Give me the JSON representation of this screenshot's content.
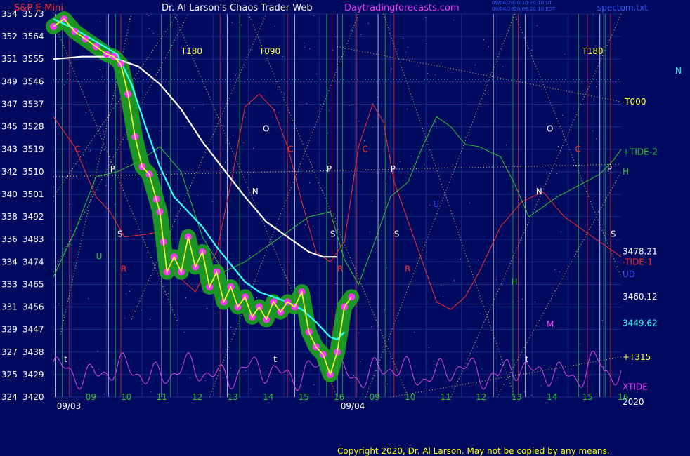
{
  "header": {
    "instrument": "S&P E-Mini",
    "title": "Dr. Al Larson's Chaos Trader Web",
    "site": "Daytradingforecasts.com",
    "stamp_line1": "09/04/2020 10:20:10 UT",
    "stamp_line2": "09/04/2020 06:20:10 EDT",
    "file": "spectom.txt",
    "corner_mark": "N"
  },
  "copyright": "Copyright 2020, Dr. Al Larson. May not be copied by any means.",
  "colors": {
    "background": "#000a5e",
    "price_band": "#1ea51e",
    "price_dots": "#ff33ff",
    "price_line": "#ffff33",
    "white_ma": "#ffffff",
    "cyan_ma": "#33ffff",
    "tide_red": "#ff2a2a",
    "tide_green": "#2ec52e",
    "xtide": "#e040e0"
  },
  "chart_data": {
    "type": "line",
    "title": "S&P E-Mini",
    "y_axis": {
      "ylim": [
        3420,
        3573
      ],
      "ticks": [
        {
          "price": 3573,
          "code": "354"
        },
        {
          "price": 3564,
          "code": "352"
        },
        {
          "price": 3555,
          "code": "351"
        },
        {
          "price": 3546,
          "code": "349"
        },
        {
          "price": 3537,
          "code": "347"
        },
        {
          "price": 3528,
          "code": "345"
        },
        {
          "price": 3519,
          "code": "343"
        },
        {
          "price": 3510,
          "code": "342"
        },
        {
          "price": 3501,
          "code": "340"
        },
        {
          "price": 3492,
          "code": "338"
        },
        {
          "price": 3483,
          "code": "336"
        },
        {
          "price": 3474,
          "code": "334"
        },
        {
          "price": 3465,
          "code": "333"
        },
        {
          "price": 3456,
          "code": "331"
        },
        {
          "price": 3447,
          "code": "329"
        },
        {
          "price": 3438,
          "code": "327"
        },
        {
          "price": 3429,
          "code": "325"
        },
        {
          "price": 3420,
          "code": "324"
        }
      ]
    },
    "x_axis": {
      "xlim": [
        0,
        32
      ],
      "hour_ticks": [
        {
          "x": 1,
          "label": "09"
        },
        {
          "x": 2,
          "label": "10"
        },
        {
          "x": 3,
          "label": "11"
        },
        {
          "x": 4,
          "label": "12"
        },
        {
          "x": 5,
          "label": "13"
        },
        {
          "x": 6,
          "label": "14"
        },
        {
          "x": 7,
          "label": "15"
        },
        {
          "x": 8,
          "label": "16"
        },
        {
          "x": 9,
          "label": "09"
        },
        {
          "x": 10,
          "label": "10"
        },
        {
          "x": 11,
          "label": "11"
        },
        {
          "x": 12,
          "label": "12"
        },
        {
          "x": 13,
          "label": "13"
        },
        {
          "x": 14,
          "label": "14"
        },
        {
          "x": 15,
          "label": "15"
        },
        {
          "x": 16,
          "label": "16"
        }
      ],
      "date_labels": [
        {
          "x": 0.5,
          "label": "09/03"
        },
        {
          "x": 8.5,
          "label": "09/04"
        }
      ]
    },
    "series": [
      {
        "name": "price",
        "points": [
          [
            0,
            3568
          ],
          [
            0.3,
            3571
          ],
          [
            0.6,
            3566
          ],
          [
            0.9,
            3563
          ],
          [
            1.2,
            3560
          ],
          [
            1.5,
            3557
          ],
          [
            1.7,
            3556
          ],
          [
            1.9,
            3553
          ],
          [
            2.1,
            3541
          ],
          [
            2.3,
            3524
          ],
          [
            2.5,
            3512
          ],
          [
            2.7,
            3509
          ],
          [
            2.9,
            3499
          ],
          [
            3.0,
            3494
          ],
          [
            3.1,
            3482
          ],
          [
            3.2,
            3470
          ],
          [
            3.4,
            3476
          ],
          [
            3.6,
            3470
          ],
          [
            3.8,
            3484
          ],
          [
            4.0,
            3472
          ],
          [
            4.2,
            3478
          ],
          [
            4.4,
            3464
          ],
          [
            4.6,
            3470
          ],
          [
            4.8,
            3458
          ],
          [
            5.0,
            3464
          ],
          [
            5.2,
            3456
          ],
          [
            5.4,
            3460
          ],
          [
            5.6,
            3452
          ],
          [
            5.8,
            3456
          ],
          [
            6.0,
            3451
          ],
          [
            6.2,
            3458
          ],
          [
            6.4,
            3454
          ],
          [
            6.6,
            3458
          ],
          [
            6.8,
            3456
          ],
          [
            7.0,
            3462
          ],
          [
            7.2,
            3446
          ],
          [
            7.4,
            3440
          ],
          [
            7.6,
            3437
          ],
          [
            7.8,
            3429
          ],
          [
            8.0,
            3438
          ],
          [
            8.2,
            3456
          ],
          [
            8.4,
            3460
          ]
        ]
      },
      {
        "name": "white average",
        "points": [
          [
            0,
            3555
          ],
          [
            0.8,
            3556
          ],
          [
            1.6,
            3556
          ],
          [
            2.4,
            3552
          ],
          [
            3.0,
            3545
          ],
          [
            3.6,
            3535
          ],
          [
            4.2,
            3522
          ],
          [
            4.8,
            3511
          ],
          [
            5.4,
            3500
          ],
          [
            6.0,
            3490
          ],
          [
            6.6,
            3484
          ],
          [
            7.2,
            3478
          ],
          [
            7.6,
            3476
          ],
          [
            8.0,
            3476
          ]
        ]
      },
      {
        "name": "cyan average",
        "points": [
          [
            0,
            3571
          ],
          [
            0.6,
            3567
          ],
          [
            1.2,
            3562
          ],
          [
            1.8,
            3557
          ],
          [
            2.2,
            3545
          ],
          [
            2.6,
            3528
          ],
          [
            3.0,
            3512
          ],
          [
            3.4,
            3500
          ],
          [
            3.8,
            3494
          ],
          [
            4.2,
            3488
          ],
          [
            4.6,
            3480
          ],
          [
            5.0,
            3473
          ],
          [
            5.4,
            3466
          ],
          [
            5.8,
            3462
          ],
          [
            6.2,
            3460
          ],
          [
            6.6,
            3458
          ],
          [
            7.0,
            3455
          ],
          [
            7.4,
            3450
          ],
          [
            7.8,
            3444
          ],
          [
            8.0,
            3443
          ],
          [
            8.2,
            3446
          ]
        ]
      },
      {
        "name": "tide red",
        "points": [
          [
            0,
            3532
          ],
          [
            0.6,
            3520
          ],
          [
            1.2,
            3500
          ],
          [
            1.6,
            3494
          ],
          [
            2.0,
            3484
          ],
          [
            2.6,
            3485
          ],
          [
            3.0,
            3486
          ],
          [
            3.4,
            3470
          ],
          [
            4.0,
            3462
          ],
          [
            4.6,
            3478
          ],
          [
            5.0,
            3505
          ],
          [
            5.4,
            3536
          ],
          [
            5.8,
            3541
          ],
          [
            6.2,
            3535
          ],
          [
            6.6,
            3520
          ],
          [
            7.0,
            3498
          ],
          [
            7.4,
            3478
          ],
          [
            7.8,
            3474
          ],
          [
            8.2,
            3482
          ],
          [
            8.6,
            3520
          ],
          [
            9.0,
            3537
          ],
          [
            9.3,
            3530
          ],
          [
            9.6,
            3506
          ],
          [
            10.0,
            3490
          ],
          [
            10.4,
            3474
          ],
          [
            10.8,
            3458
          ],
          [
            11.2,
            3455
          ],
          [
            11.6,
            3460
          ],
          [
            12.0,
            3470
          ],
          [
            12.6,
            3488
          ],
          [
            13.2,
            3498
          ],
          [
            13.8,
            3502
          ],
          [
            14.4,
            3492
          ],
          [
            15.0,
            3486
          ],
          [
            15.6,
            3480
          ],
          [
            16.0,
            3476
          ]
        ]
      },
      {
        "name": "tide green",
        "points": [
          [
            0,
            3468
          ],
          [
            0.6,
            3486
          ],
          [
            1.2,
            3508
          ],
          [
            1.8,
            3510
          ],
          [
            2.4,
            3514
          ],
          [
            3.0,
            3520
          ],
          [
            3.6,
            3510
          ],
          [
            4.2,
            3484
          ],
          [
            4.8,
            3470
          ],
          [
            5.4,
            3474
          ],
          [
            6.0,
            3480
          ],
          [
            6.6,
            3486
          ],
          [
            7.2,
            3492
          ],
          [
            7.8,
            3494
          ],
          [
            8.2,
            3475
          ],
          [
            8.6,
            3465
          ],
          [
            9.0,
            3480
          ],
          [
            9.5,
            3500
          ],
          [
            10.0,
            3506
          ],
          [
            10.4,
            3520
          ],
          [
            10.8,
            3532
          ],
          [
            11.2,
            3528
          ],
          [
            11.6,
            3521
          ],
          [
            12.0,
            3520
          ],
          [
            12.6,
            3516
          ],
          [
            13.0,
            3505
          ],
          [
            13.4,
            3492
          ],
          [
            13.8,
            3496
          ],
          [
            14.2,
            3500
          ],
          [
            14.6,
            3503
          ],
          [
            15.0,
            3506
          ],
          [
            15.4,
            3509
          ],
          [
            15.8,
            3515
          ],
          [
            16.0,
            3519
          ]
        ]
      }
    ],
    "level_labels": [
      {
        "text": "-T000",
        "price": 3538,
        "color": "#ffff33"
      },
      {
        "text": "+TIDE-2",
        "price": 3518,
        "color": "#2ec52e"
      },
      {
        "text": "H",
        "price": 3510,
        "color": "#2ec52e"
      },
      {
        "text": "3478.21",
        "price": 3478.21,
        "color": "#ffffff"
      },
      {
        "text": "-TIDE-1",
        "price": 3474,
        "color": "#ff2a2a"
      },
      {
        "text": "UD",
        "price": 3469,
        "color": "#3a4cff"
      },
      {
        "text": "3460.12",
        "price": 3460.12,
        "color": "#ffffff"
      },
      {
        "text": "3449.62",
        "price": 3449.62,
        "color": "#33ffff"
      },
      {
        "text": "+T315",
        "price": 3436,
        "color": "#ffff33"
      },
      {
        "text": "XTIDE",
        "price": 3424,
        "color": "#ff33ff"
      },
      {
        "text": "2020",
        "price": 3418,
        "color": "#ffffff"
      }
    ],
    "annotations": [
      {
        "text": "T180",
        "x": 3.6,
        "price": 3557,
        "color": "#ffff33"
      },
      {
        "text": "T090",
        "x": 5.8,
        "price": 3557,
        "color": "#ffff33"
      },
      {
        "text": "T180",
        "x": 14.9,
        "price": 3557,
        "color": "#ffff33"
      },
      {
        "text": "C",
        "x": 0.6,
        "price": 3518,
        "color": "#ff2a2a"
      },
      {
        "text": "C",
        "x": 6.6,
        "price": 3518,
        "color": "#ff2a2a"
      },
      {
        "text": "C",
        "x": 8.7,
        "price": 3518,
        "color": "#ff2a2a"
      },
      {
        "text": "C",
        "x": 14.7,
        "price": 3518,
        "color": "#ff2a2a"
      },
      {
        "text": "P",
        "x": 1.6,
        "price": 3510,
        "color": "#ffffff"
      },
      {
        "text": "P",
        "x": 7.7,
        "price": 3510,
        "color": "#ffffff"
      },
      {
        "text": "P",
        "x": 9.5,
        "price": 3510,
        "color": "#ffffff"
      },
      {
        "text": "P",
        "x": 15.6,
        "price": 3510,
        "color": "#ffffff"
      },
      {
        "text": "O",
        "x": 5.9,
        "price": 3526,
        "color": "#ffffff"
      },
      {
        "text": "O",
        "x": 13.9,
        "price": 3526,
        "color": "#ffffff"
      },
      {
        "text": "N",
        "x": 5.6,
        "price": 3501,
        "color": "#ffffff"
      },
      {
        "text": "N",
        "x": 13.6,
        "price": 3501,
        "color": "#ffffff"
      },
      {
        "text": "S",
        "x": 1.8,
        "price": 3484,
        "color": "#ffffff"
      },
      {
        "text": "S",
        "x": 7.8,
        "price": 3484,
        "color": "#ffffff"
      },
      {
        "text": "S",
        "x": 9.6,
        "price": 3484,
        "color": "#ffffff"
      },
      {
        "text": "S",
        "x": 15.7,
        "price": 3484,
        "color": "#ffffff"
      },
      {
        "text": "R",
        "x": 1.9,
        "price": 3470,
        "color": "#ff2a2a"
      },
      {
        "text": "R",
        "x": 8.0,
        "price": 3470,
        "color": "#ff2a2a"
      },
      {
        "text": "R",
        "x": 9.9,
        "price": 3470,
        "color": "#ff2a2a"
      },
      {
        "text": "U",
        "x": 1.2,
        "price": 3475,
        "color": "#2ec52e"
      },
      {
        "text": "U",
        "x": 10.7,
        "price": 3496,
        "color": "#3a4cff"
      },
      {
        "text": "H",
        "x": 12.9,
        "price": 3465,
        "color": "#2ec52e"
      },
      {
        "text": "M",
        "x": 13.9,
        "price": 3448,
        "color": "#ff33ff"
      },
      {
        "text": "t",
        "x": 0.3,
        "price": 3434,
        "color": "#ffffff"
      },
      {
        "text": "t",
        "x": 6.2,
        "price": 3434,
        "color": "#ffffff"
      },
      {
        "text": "t",
        "x": 13.3,
        "price": 3434,
        "color": "#ffffff"
      }
    ],
    "legend": "none",
    "grid": true
  }
}
